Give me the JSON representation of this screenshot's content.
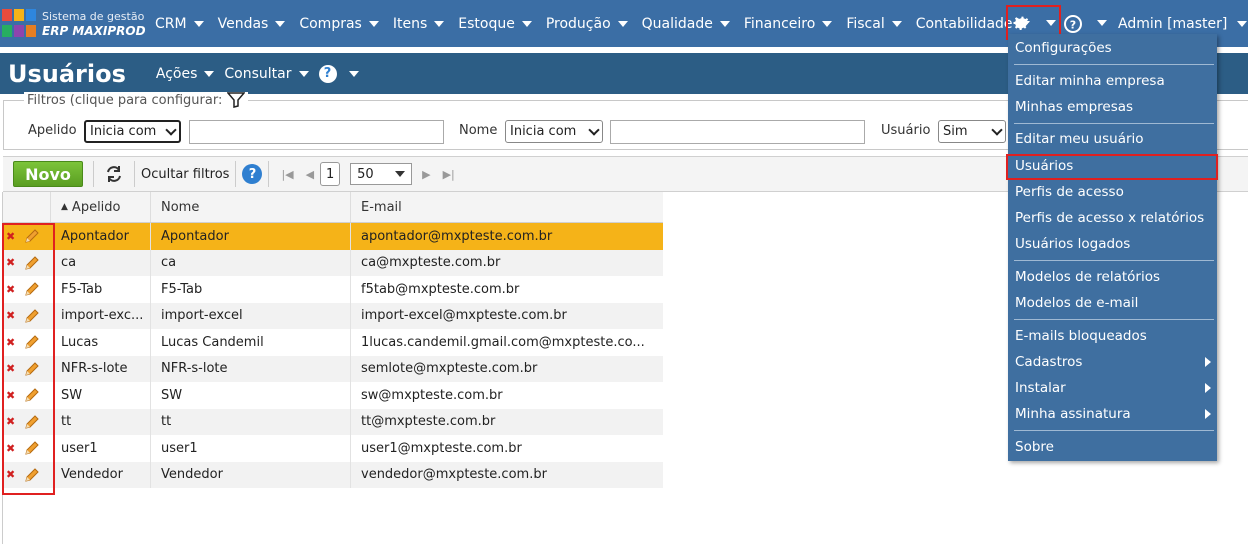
{
  "app": {
    "logo_line1": "Sistema de gestão",
    "logo_line2": "ERP MAXIPROD",
    "logo_colors": [
      "#e84c3d",
      "#f5b318",
      "#2e86de",
      "#27ae60",
      "#8e44ad",
      "#e67e22"
    ]
  },
  "nav": {
    "items": [
      "CRM",
      "Vendas",
      "Compras",
      "Itens",
      "Estoque",
      "Produção",
      "Qualidade",
      "Financeiro",
      "Fiscal",
      "Contabilidade"
    ],
    "settings_icon": "gear-icon",
    "help_icon": "help-icon",
    "user": "Admin [master]"
  },
  "titlebar": {
    "title": "Usuários",
    "actions": "Ações",
    "consult": "Consultar",
    "help": "?"
  },
  "filters": {
    "legend": "Filtros (clique para configurar:",
    "apelido_label": "Apelido",
    "apelido_mode": "Inicia com",
    "nome_label": "Nome",
    "nome_mode": "Inicia com",
    "usuario_label": "Usuário",
    "usuario_value": "Sim"
  },
  "toolbar": {
    "new_label": "Novo",
    "hide_filters": "Ocultar filtros",
    "help": "?",
    "page": "1",
    "page_size": "50"
  },
  "grid": {
    "columns": [
      "Apelido",
      "Nome",
      "E-mail"
    ],
    "rows": [
      {
        "apelido": "Apontador",
        "nome": "Apontador",
        "email": "apontador@mxpteste.com.br"
      },
      {
        "apelido": "ca",
        "nome": "ca",
        "email": "ca@mxpteste.com.br"
      },
      {
        "apelido": "F5-Tab",
        "nome": "F5-Tab",
        "email": "f5tab@mxpteste.com.br"
      },
      {
        "apelido": "import-exc...",
        "nome": "import-excel",
        "email": "import-excel@mxpteste.com.br"
      },
      {
        "apelido": "Lucas",
        "nome": "Lucas Candemil",
        "email": "1lucas.candemil.gmail.com@mxpteste.co..."
      },
      {
        "apelido": "NFR-s-lote",
        "nome": "NFR-s-lote",
        "email": "semlote@mxpteste.com.br"
      },
      {
        "apelido": "SW",
        "nome": "SW",
        "email": "sw@mxpteste.com.br"
      },
      {
        "apelido": "tt",
        "nome": "tt",
        "email": "tt@mxpteste.com.br"
      },
      {
        "apelido": "user1",
        "nome": "user1",
        "email": "user1@mxpteste.com.br"
      },
      {
        "apelido": "Vendedor",
        "nome": "Vendedor",
        "email": "vendedor@mxpteste.com.br"
      }
    ]
  },
  "menu": {
    "items": [
      {
        "label": "Configurações"
      },
      {
        "label": "Editar minha empresa"
      },
      {
        "label": "Minhas empresas"
      },
      {
        "label": "Editar meu usuário"
      },
      {
        "label": "Usuários"
      },
      {
        "label": "Perfis de acesso"
      },
      {
        "label": "Perfis de acesso x relatórios"
      },
      {
        "label": "Usuários logados"
      },
      {
        "label": "Modelos de relatórios"
      },
      {
        "label": "Modelos de e-mail"
      },
      {
        "label": "E-mails bloqueados"
      },
      {
        "label": "Cadastros"
      },
      {
        "label": "Instalar"
      },
      {
        "label": "Minha assinatura"
      },
      {
        "label": "Sobre"
      }
    ]
  }
}
